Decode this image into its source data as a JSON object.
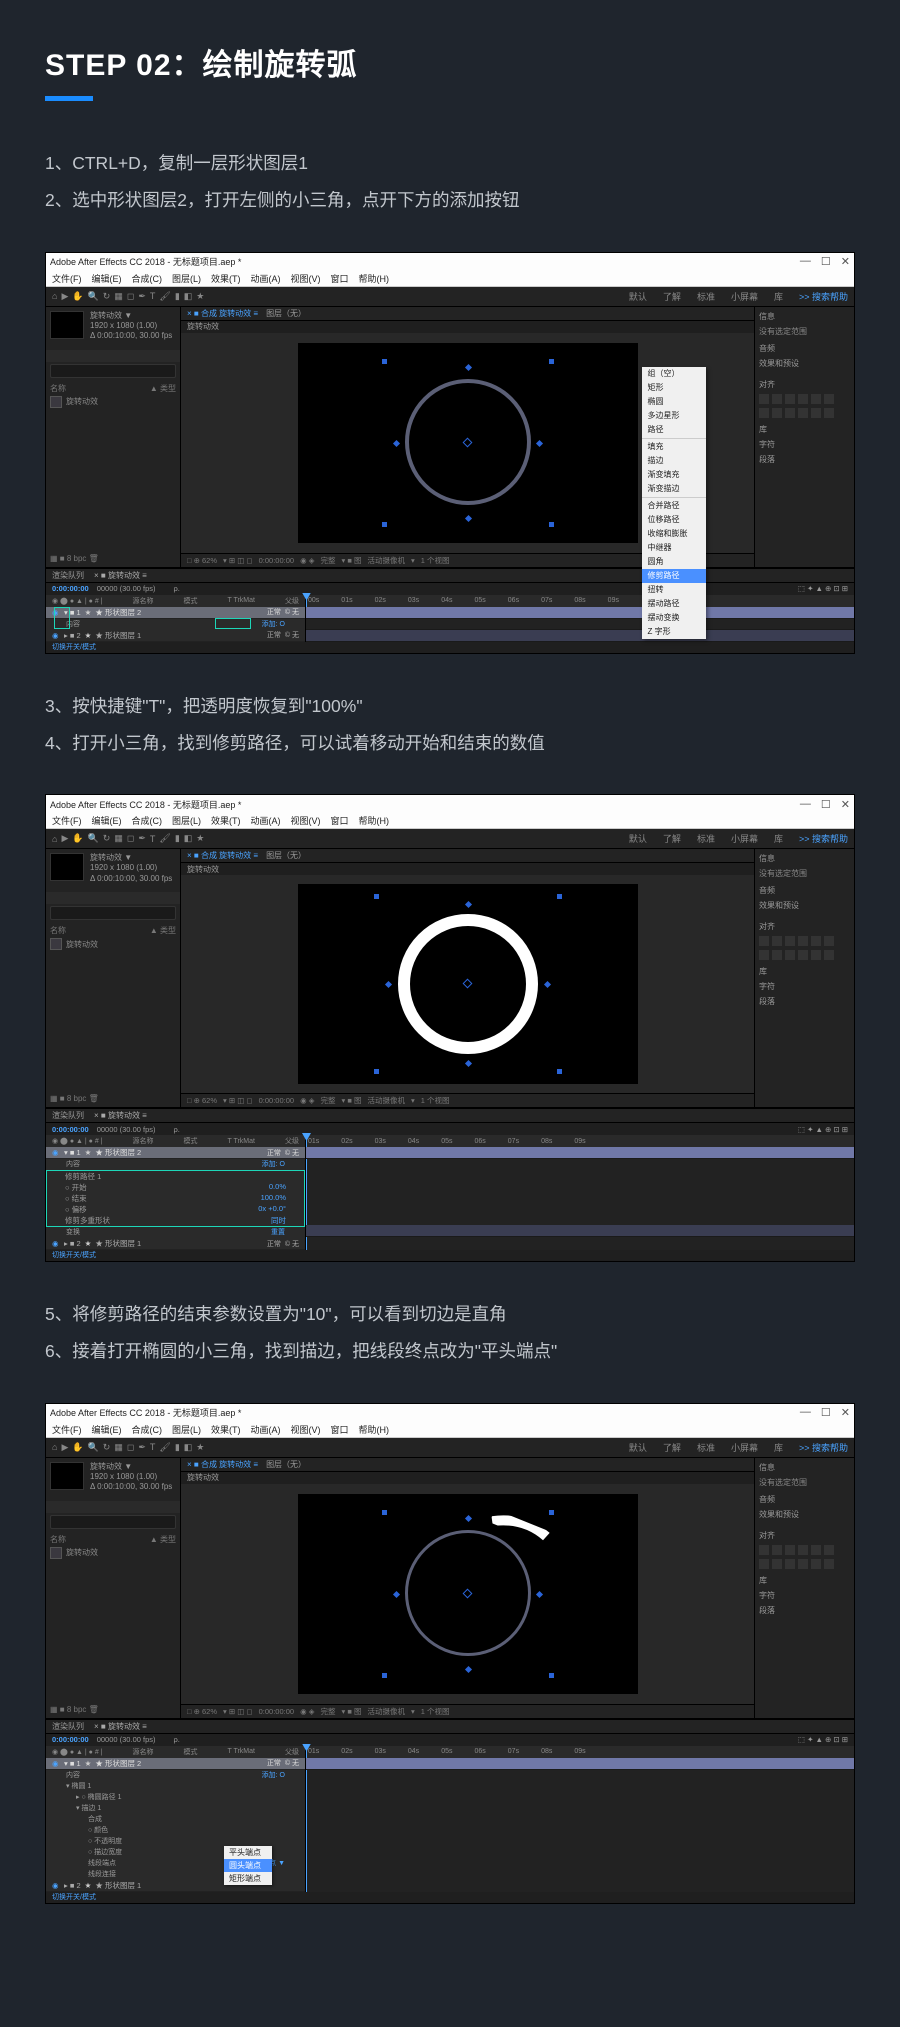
{
  "header": {
    "title": "STEP 02：绘制旋转弧"
  },
  "sectionA": {
    "line1": "1、CTRL+D，复制一层形状图层1",
    "line2": "2、选中形状图层2，打开左侧的小三角，点开下方的添加按钮"
  },
  "sectionB": {
    "line1": "3、按快捷键\"T\"，把透明度恢复到\"100%\"",
    "line2": "4、打开小三角，找到修剪路径，可以试着移动开始和结束的数值"
  },
  "sectionC": {
    "line1": "5、将修剪路径的结束参数设置为\"10\"，可以看到切边是直角",
    "line2": "6、接着打开椭圆的小三角，找到描边，把线段终点改为\"平头端点\""
  },
  "ae": {
    "windowTitle": "Adobe After Effects CC 2018 - 无标题项目.aep *",
    "menus": [
      "文件(F)",
      "编辑(E)",
      "合成(C)",
      "图层(L)",
      "效果(T)",
      "动画(A)",
      "视图(V)",
      "窗口",
      "帮助(H)"
    ],
    "workspace": {
      "right": [
        "默认",
        "了解",
        "标准",
        "小屏幕",
        "库"
      ],
      "search": ">> 搜索帮助"
    },
    "projPanel": {
      "name": "旋转动效 ▼",
      "meta": "1920 x 1080 (1.00)",
      "fps": "Δ 0:00:10:00, 30.00 fps"
    },
    "projHeaders": {
      "a": "名称",
      "b": "▲ 类型"
    },
    "projItem": "旋转动效",
    "compTab": "× ■ 合成 旋转动效 ≡",
    "compName": "旋转动效",
    "layerTab": "图层（无）",
    "footer": {
      "zoom": "□ ⊕ 62%",
      "res": "完整",
      "time": "0:00:00:00",
      "extra": "活动摄像机",
      "view": "1 个视图"
    },
    "rightPanel": {
      "a": "信息",
      "b": "没有选定范围",
      "c": "音频",
      "d": "效果和预设",
      "e": "对齐",
      "f": "库",
      "g": "字符",
      "h": "段落"
    },
    "timeline": {
      "tab1": "渲染队列",
      "tab2": "× ■ 旋转动效 ≡",
      "time": "0:00:00:00",
      "frame": "00000 (30.00 fps)",
      "search": "ρ.",
      "cols": {
        "a": "源名称",
        "b": "模式",
        "c": "T TrkMat",
        "d": "父级"
      },
      "layer1": "★ 形状图层 2",
      "layer2": "★ 形状图层 1",
      "mode": "正常",
      "parent": "© 无",
      "add": "添加: O",
      "contents": "内容",
      "transform": "变换",
      "reset": "重置",
      "ruler": [
        "00s",
        "01s",
        "02s",
        "03s",
        "04s",
        "05s",
        "06s",
        "07s",
        "08s",
        "09s"
      ],
      "toggle": "切换开关/模式"
    },
    "contextMenu": {
      "items": [
        "组（空）",
        "矩形",
        "椭圆",
        "多边星形",
        "路径"
      ],
      "items2": [
        "填充",
        "描边",
        "渐变填充",
        "渐变描边"
      ],
      "items3": [
        "合并路径",
        "位移路径",
        "收缩和膨胀",
        "中继器",
        "圆角"
      ],
      "highlighted": "修剪路径",
      "items4": [
        "扭转",
        "摆动路径",
        "摆动变换",
        "Z 字形"
      ]
    },
    "trimPanel": {
      "title": "修剪路径 1",
      "rows": [
        {
          "k": "○ 开始",
          "v": "0.0%"
        },
        {
          "k": "○ 结束",
          "v": "100.0%"
        },
        {
          "k": "○ 偏移",
          "v": "0x +0.0°"
        },
        {
          "k": "修剪多重形状",
          "v": "同时"
        }
      ]
    },
    "shot3": {
      "ellipse": "椭圆 1",
      "ellipsePath": "○ 椭圆路径 1",
      "stroke": "描边 1",
      "composite": "合成",
      "strokeColor": "○ 颜色",
      "opacity": "○ 不透明度",
      "strokeWidth": "○ 描边宽度",
      "lineEnd": "线段端点",
      "endVal": "平头端点 ▼",
      "lineJoin": "线段连接",
      "cut": "切换开关"
    },
    "endcapMenu": {
      "a": "平头端点",
      "b": "圆头端点",
      "c": "矩形端点"
    }
  }
}
